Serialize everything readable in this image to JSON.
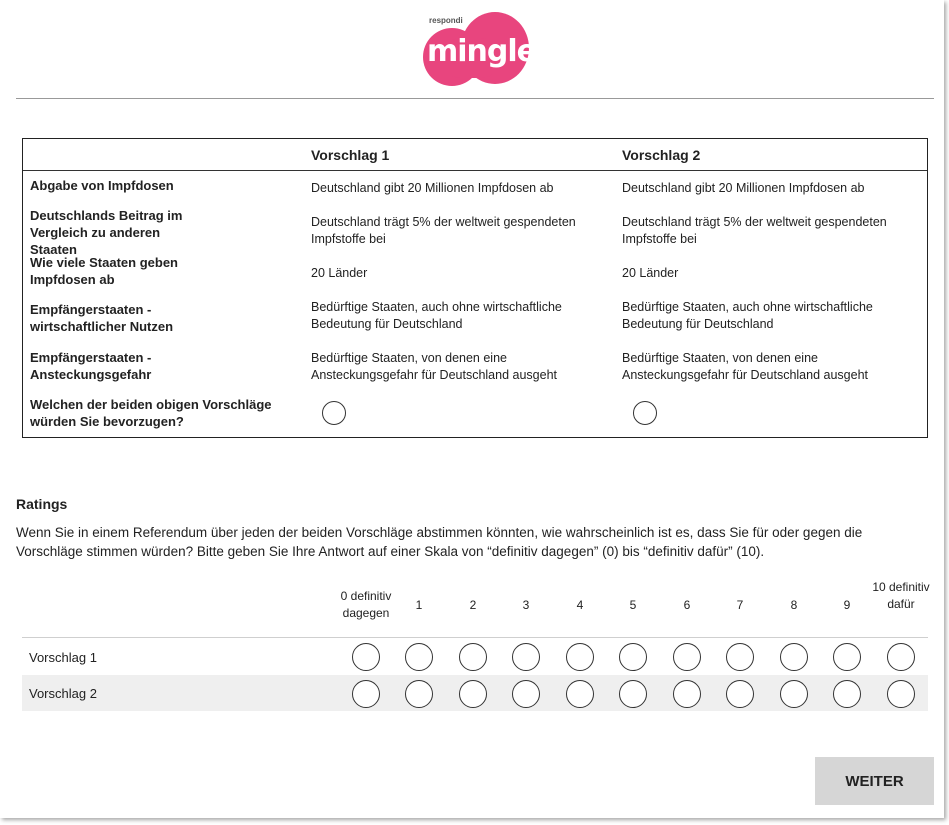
{
  "logo": {
    "small_text": "respondi",
    "word": "mingle",
    "color": "#e8457e"
  },
  "comparison": {
    "headers": [
      "Vorschlag 1",
      "Vorschlag 2"
    ],
    "rows": [
      {
        "label": "Abgabe von Impfdosen",
        "v1": "Deutschland gibt 20 Millionen Impfdosen ab",
        "v2": "Deutschland gibt 20 Millionen Impfdosen ab"
      },
      {
        "label": "Deutschlands Beitrag im Vergleich zu anderen Staaten",
        "v1": "Deutschland trägt 5% der weltweit gespendeten Impfstoffe bei",
        "v2": "Deutschland trägt 5% der weltweit gespendeten Impfstoffe bei"
      },
      {
        "label": "Wie viele Staaten geben Impfdosen ab",
        "v1": "20 Länder",
        "v2": "20 Länder"
      },
      {
        "label": "Empfängerstaaten - wirtschaftlicher Nutzen",
        "v1": "Bedürftige Staaten, auch ohne wirtschaftliche Bedeutung für Deutschland",
        "v2": "Bedürftige Staaten, auch ohne wirtschaftliche Bedeutung für Deutschland"
      },
      {
        "label": "Empfängerstaaten - Ansteckungsgefahr",
        "v1": "Bedürftige Staaten, von denen eine Ansteckungsgefahr für Deutschland ausgeht",
        "v2": "Bedürftige Staaten, von denen eine Ansteckungsgefahr für Deutschland ausgeht"
      }
    ],
    "question": "Welchen der beiden obigen Vorschläge würden Sie bevorzugen?"
  },
  "ratings": {
    "title": "Ratings",
    "description": "Wenn Sie in einem Referendum über jeden der beiden Vorschläge abstimmen könnten, wie wahrscheinlich ist es, dass Sie für oder gegen die Vorschläge stimmen würden? Bitte geben Sie Ihre Antwort auf einer Skala von “definitiv dagegen” (0) bis “definitiv dafür” (10).",
    "scale": [
      "0 definitiv dagegen",
      "1",
      "2",
      "3",
      "4",
      "5",
      "6",
      "7",
      "8",
      "9",
      "10 definitiv dafür"
    ],
    "rows": [
      "Vorschlag 1",
      "Vorschlag 2"
    ]
  },
  "button": {
    "label": "WEITER"
  }
}
